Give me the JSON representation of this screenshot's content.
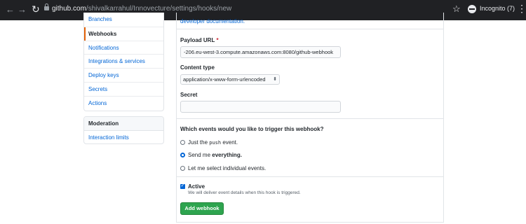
{
  "browser": {
    "url_host": "github.com",
    "url_path": "/shivalkarrahul/Innovecture/settings/hooks/new",
    "incognito_label": "Incognito (7)",
    "icons": [
      "back-icon",
      "forward-icon",
      "reload-icon",
      "lock-icon",
      "star-icon",
      "incognito-icon",
      "menu-icon"
    ]
  },
  "sidebar": {
    "items": [
      {
        "label": "Branches",
        "active": false
      },
      {
        "label": "Webhooks",
        "active": true
      },
      {
        "label": "Notifications",
        "active": false
      },
      {
        "label": "Integrations & services",
        "active": false
      },
      {
        "label": "Deploy keys",
        "active": false
      },
      {
        "label": "Secrets",
        "active": false
      },
      {
        "label": "Actions",
        "active": false
      }
    ],
    "moderation": {
      "heading": "Moderation",
      "items": [
        {
          "label": "Interaction limits"
        }
      ]
    }
  },
  "form": {
    "doc_link": "developer documentation.",
    "payload_url": {
      "label": "Payload URL",
      "required_mark": "*",
      "value": "-206.eu-west-3.compute.amazonaws.com:8080/github-webhook"
    },
    "content_type": {
      "label": "Content type",
      "value": "application/x-www-form-urlencoded"
    },
    "secret": {
      "label": "Secret",
      "value": ""
    },
    "events": {
      "question": "Which events would you like to trigger this webhook?",
      "option1": {
        "prefix": "Just the ",
        "code": "push",
        "suffix": " event.",
        "selected": false
      },
      "option2": {
        "prefix": "Send me ",
        "bold": "everything.",
        "selected": true
      },
      "option3": {
        "label": "Let me select individual events.",
        "selected": false
      }
    },
    "active": {
      "label": "Active",
      "checked": true,
      "note": "We will deliver event details when this hook is triggered."
    },
    "submit_label": "Add webhook"
  },
  "colors": {
    "link": "#0366d6",
    "accent_orange": "#e36209",
    "button_green": "#2ea44f",
    "chrome_bg": "#202124"
  }
}
